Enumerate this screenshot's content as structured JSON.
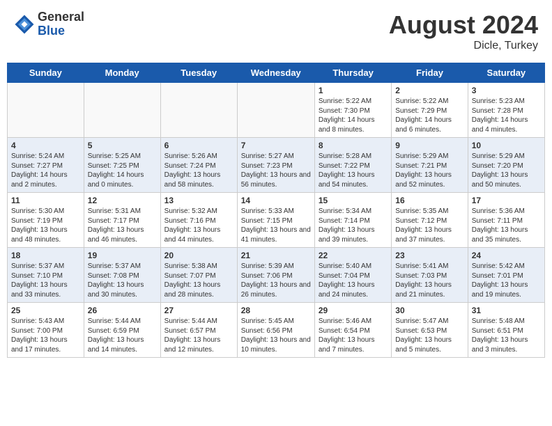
{
  "header": {
    "logo_general": "General",
    "logo_blue": "Blue",
    "month_year": "August 2024",
    "location": "Dicle, Turkey"
  },
  "weekdays": [
    "Sunday",
    "Monday",
    "Tuesday",
    "Wednesday",
    "Thursday",
    "Friday",
    "Saturday"
  ],
  "weeks": [
    [
      {
        "day": "",
        "info": ""
      },
      {
        "day": "",
        "info": ""
      },
      {
        "day": "",
        "info": ""
      },
      {
        "day": "",
        "info": ""
      },
      {
        "day": "1",
        "info": "Sunrise: 5:22 AM\nSunset: 7:30 PM\nDaylight: 14 hours\nand 8 minutes."
      },
      {
        "day": "2",
        "info": "Sunrise: 5:22 AM\nSunset: 7:29 PM\nDaylight: 14 hours\nand 6 minutes."
      },
      {
        "day": "3",
        "info": "Sunrise: 5:23 AM\nSunset: 7:28 PM\nDaylight: 14 hours\nand 4 minutes."
      }
    ],
    [
      {
        "day": "4",
        "info": "Sunrise: 5:24 AM\nSunset: 7:27 PM\nDaylight: 14 hours\nand 2 minutes."
      },
      {
        "day": "5",
        "info": "Sunrise: 5:25 AM\nSunset: 7:25 PM\nDaylight: 14 hours\nand 0 minutes."
      },
      {
        "day": "6",
        "info": "Sunrise: 5:26 AM\nSunset: 7:24 PM\nDaylight: 13 hours\nand 58 minutes."
      },
      {
        "day": "7",
        "info": "Sunrise: 5:27 AM\nSunset: 7:23 PM\nDaylight: 13 hours\nand 56 minutes."
      },
      {
        "day": "8",
        "info": "Sunrise: 5:28 AM\nSunset: 7:22 PM\nDaylight: 13 hours\nand 54 minutes."
      },
      {
        "day": "9",
        "info": "Sunrise: 5:29 AM\nSunset: 7:21 PM\nDaylight: 13 hours\nand 52 minutes."
      },
      {
        "day": "10",
        "info": "Sunrise: 5:29 AM\nSunset: 7:20 PM\nDaylight: 13 hours\nand 50 minutes."
      }
    ],
    [
      {
        "day": "11",
        "info": "Sunrise: 5:30 AM\nSunset: 7:19 PM\nDaylight: 13 hours\nand 48 minutes."
      },
      {
        "day": "12",
        "info": "Sunrise: 5:31 AM\nSunset: 7:17 PM\nDaylight: 13 hours\nand 46 minutes."
      },
      {
        "day": "13",
        "info": "Sunrise: 5:32 AM\nSunset: 7:16 PM\nDaylight: 13 hours\nand 44 minutes."
      },
      {
        "day": "14",
        "info": "Sunrise: 5:33 AM\nSunset: 7:15 PM\nDaylight: 13 hours\nand 41 minutes."
      },
      {
        "day": "15",
        "info": "Sunrise: 5:34 AM\nSunset: 7:14 PM\nDaylight: 13 hours\nand 39 minutes."
      },
      {
        "day": "16",
        "info": "Sunrise: 5:35 AM\nSunset: 7:12 PM\nDaylight: 13 hours\nand 37 minutes."
      },
      {
        "day": "17",
        "info": "Sunrise: 5:36 AM\nSunset: 7:11 PM\nDaylight: 13 hours\nand 35 minutes."
      }
    ],
    [
      {
        "day": "18",
        "info": "Sunrise: 5:37 AM\nSunset: 7:10 PM\nDaylight: 13 hours\nand 33 minutes."
      },
      {
        "day": "19",
        "info": "Sunrise: 5:37 AM\nSunset: 7:08 PM\nDaylight: 13 hours\nand 30 minutes."
      },
      {
        "day": "20",
        "info": "Sunrise: 5:38 AM\nSunset: 7:07 PM\nDaylight: 13 hours\nand 28 minutes."
      },
      {
        "day": "21",
        "info": "Sunrise: 5:39 AM\nSunset: 7:06 PM\nDaylight: 13 hours\nand 26 minutes."
      },
      {
        "day": "22",
        "info": "Sunrise: 5:40 AM\nSunset: 7:04 PM\nDaylight: 13 hours\nand 24 minutes."
      },
      {
        "day": "23",
        "info": "Sunrise: 5:41 AM\nSunset: 7:03 PM\nDaylight: 13 hours\nand 21 minutes."
      },
      {
        "day": "24",
        "info": "Sunrise: 5:42 AM\nSunset: 7:01 PM\nDaylight: 13 hours\nand 19 minutes."
      }
    ],
    [
      {
        "day": "25",
        "info": "Sunrise: 5:43 AM\nSunset: 7:00 PM\nDaylight: 13 hours\nand 17 minutes."
      },
      {
        "day": "26",
        "info": "Sunrise: 5:44 AM\nSunset: 6:59 PM\nDaylight: 13 hours\nand 14 minutes."
      },
      {
        "day": "27",
        "info": "Sunrise: 5:44 AM\nSunset: 6:57 PM\nDaylight: 13 hours\nand 12 minutes."
      },
      {
        "day": "28",
        "info": "Sunrise: 5:45 AM\nSunset: 6:56 PM\nDaylight: 13 hours\nand 10 minutes."
      },
      {
        "day": "29",
        "info": "Sunrise: 5:46 AM\nSunset: 6:54 PM\nDaylight: 13 hours\nand 7 minutes."
      },
      {
        "day": "30",
        "info": "Sunrise: 5:47 AM\nSunset: 6:53 PM\nDaylight: 13 hours\nand 5 minutes."
      },
      {
        "day": "31",
        "info": "Sunrise: 5:48 AM\nSunset: 6:51 PM\nDaylight: 13 hours\nand 3 minutes."
      }
    ]
  ]
}
